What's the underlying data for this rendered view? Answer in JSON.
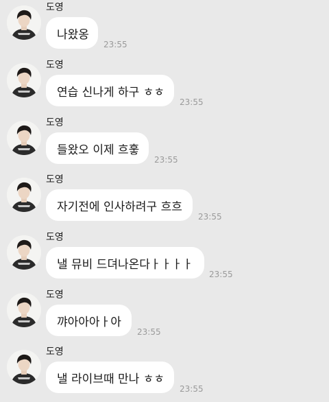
{
  "messages": [
    {
      "sender": "도영",
      "text": "나왔옹",
      "time": "23:55"
    },
    {
      "sender": "도영",
      "text": "연습 신나게 하구 ㅎㅎ",
      "time": "23:55"
    },
    {
      "sender": "도영",
      "text": "들왔오 이제 흐훟",
      "time": "23:55"
    },
    {
      "sender": "도영",
      "text": "자기전에 인사하려구 흐흐",
      "time": "23:55"
    },
    {
      "sender": "도영",
      "text": "낼 뮤비 드뎌나온다ㅏㅏㅏㅏ",
      "time": "23:55"
    },
    {
      "sender": "도영",
      "text": "꺄아아아ㅏ아",
      "time": "23:55"
    },
    {
      "sender": "도영",
      "text": "낼 라이브때 만나 ㅎㅎ",
      "time": "23:55"
    }
  ]
}
